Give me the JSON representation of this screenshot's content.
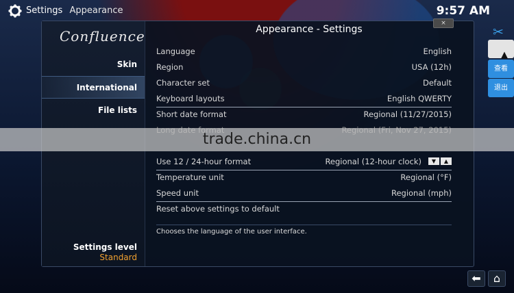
{
  "header": {
    "section": "Settings",
    "subsection": "Appearance",
    "clock": "9:57 AM"
  },
  "sidebar": {
    "logo": "Confluence",
    "items": [
      {
        "label": "Skin"
      },
      {
        "label": "International"
      },
      {
        "label": "File lists"
      }
    ],
    "settings_level_label": "Settings level",
    "settings_level_value": "Standard"
  },
  "dialog": {
    "title": "Appearance - Settings",
    "close": "×",
    "rows": [
      {
        "label": "Language",
        "value": "English"
      },
      {
        "label": "Region",
        "value": "USA (12h)"
      },
      {
        "label": "Character set",
        "value": "Default"
      },
      {
        "label": "Keyboard layouts",
        "value": "English QWERTY"
      },
      {
        "label": "Short date format",
        "value": "Regional (11/27/2015)"
      },
      {
        "label": "Long date format",
        "value": "Regional (Fri, Nov 27, 2015)"
      },
      {
        "label": "Use 12 / 24-hour format",
        "value": "Regional (12-hour clock)"
      },
      {
        "label": "Temperature unit",
        "value": "Regional (°F)"
      },
      {
        "label": "Speed unit",
        "value": "Regional (mph)"
      },
      {
        "label": "Reset above settings to default",
        "value": ""
      }
    ],
    "description": "Chooses the language of the user interface."
  },
  "watermark": "trade.china.cn",
  "side_panel": {
    "view": "查看",
    "exit": "退出"
  },
  "icons": [
    "gear-icon",
    "scissors-icon",
    "back-icon",
    "home-icon"
  ]
}
